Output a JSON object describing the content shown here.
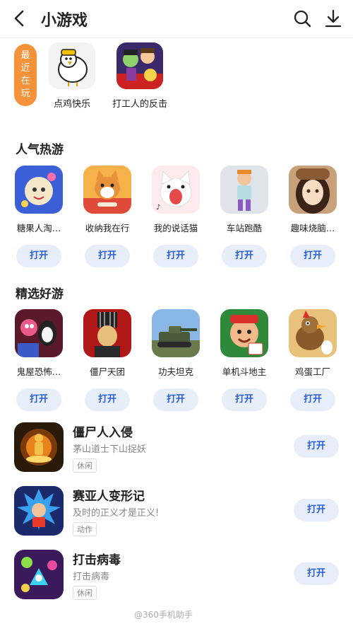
{
  "header": {
    "title": "小游戏"
  },
  "recent": {
    "tag": "最近在玩",
    "items": [
      {
        "name": "点鸡快乐",
        "icon": "chicken-game-icon"
      },
      {
        "name": "打工人的反击",
        "icon": "worker-game-icon"
      }
    ]
  },
  "popular": {
    "title": "人气热游",
    "items": [
      {
        "name": "糖果人淘…",
        "button": "打开",
        "icon": "candy-game-icon"
      },
      {
        "name": "收纳我在行",
        "button": "打开",
        "icon": "corgi-game-icon"
      },
      {
        "name": "我的说话猫",
        "button": "打开",
        "icon": "cat-game-icon"
      },
      {
        "name": "车站跑酷",
        "button": "打开",
        "icon": "runner-game-icon"
      },
      {
        "name": "趣味烧脑…",
        "button": "打开",
        "icon": "puzzle-girl-game-icon"
      }
    ]
  },
  "featured": {
    "title": "精选好游",
    "items": [
      {
        "name": "鬼屋恐怖…",
        "button": "打开",
        "icon": "haunted-house-game-icon"
      },
      {
        "name": "僵尸天团",
        "button": "打开",
        "icon": "zombie-team-game-icon"
      },
      {
        "name": "功夫坦克",
        "button": "打开",
        "icon": "tank-game-icon"
      },
      {
        "name": "单机斗地主",
        "button": "打开",
        "icon": "card-game-icon"
      },
      {
        "name": "鸡蛋工厂",
        "button": "打开",
        "icon": "egg-factory-game-icon"
      }
    ]
  },
  "list": [
    {
      "name": "僵尸人入侵",
      "desc": "茅山道士下山捉妖",
      "tag": "休闲",
      "button": "打开",
      "icon": "taoist-game-icon"
    },
    {
      "name": "赛亚人变形记",
      "desc": "及时的正义才是正义!",
      "tag": "动作",
      "button": "打开",
      "icon": "saiyan-game-icon"
    },
    {
      "name": "打击病毒",
      "desc": "打击病毒",
      "tag": "休闲",
      "button": "打开",
      "icon": "virus-game-icon"
    }
  ],
  "watermark": "@360手机助手",
  "colors": {
    "accent": "#2a5fd7",
    "button_bg": "#e8eef9",
    "recent_tag": "#f5923a"
  }
}
